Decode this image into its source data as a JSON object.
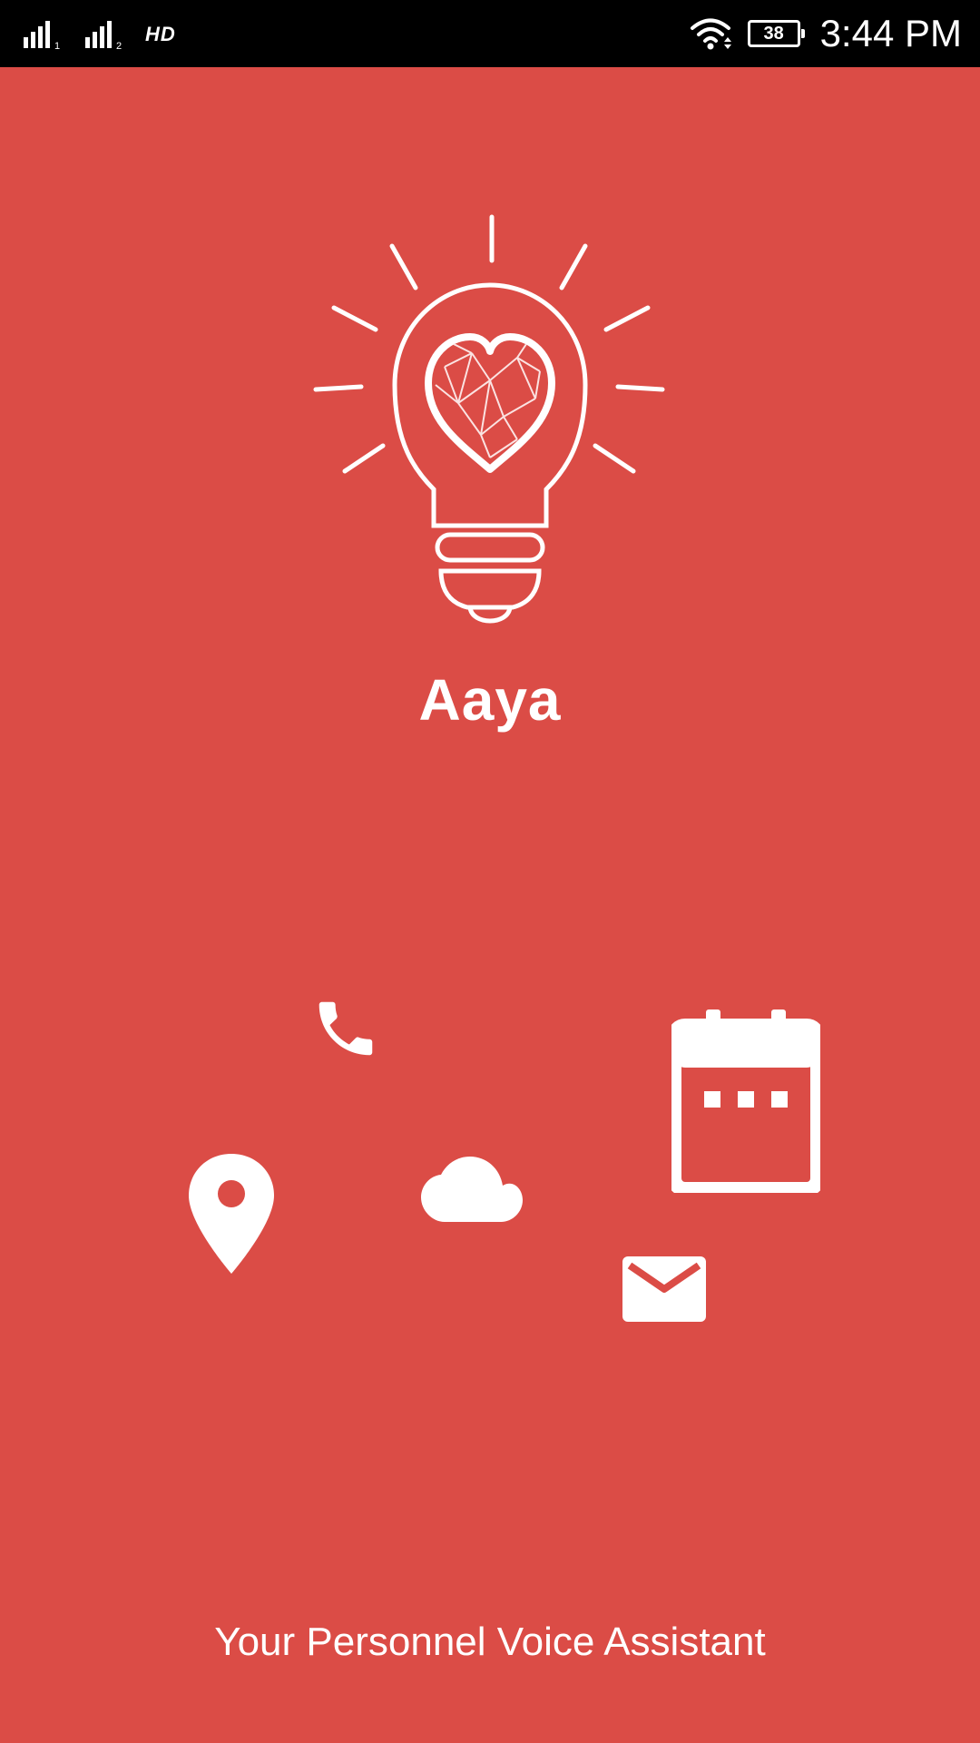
{
  "status_bar": {
    "sim1_icon": "signal-sim1-icon",
    "sim2_icon": "signal-sim2-icon",
    "network_label": "HD",
    "wifi_icon": "wifi-icon",
    "battery_level": "38",
    "time": "3:44 PM"
  },
  "app": {
    "name": "Aaya",
    "tagline": "Your Personnel Voice Assistant",
    "logo_icon": "lightbulb-heart-icon",
    "background_color": "#db4c46",
    "foreground_color": "#ffffff"
  },
  "features": [
    {
      "name": "phone",
      "icon": "phone-icon"
    },
    {
      "name": "calendar",
      "icon": "calendar-icon"
    },
    {
      "name": "location",
      "icon": "location-pin-icon"
    },
    {
      "name": "weather",
      "icon": "cloud-icon"
    },
    {
      "name": "email",
      "icon": "mail-icon"
    }
  ]
}
